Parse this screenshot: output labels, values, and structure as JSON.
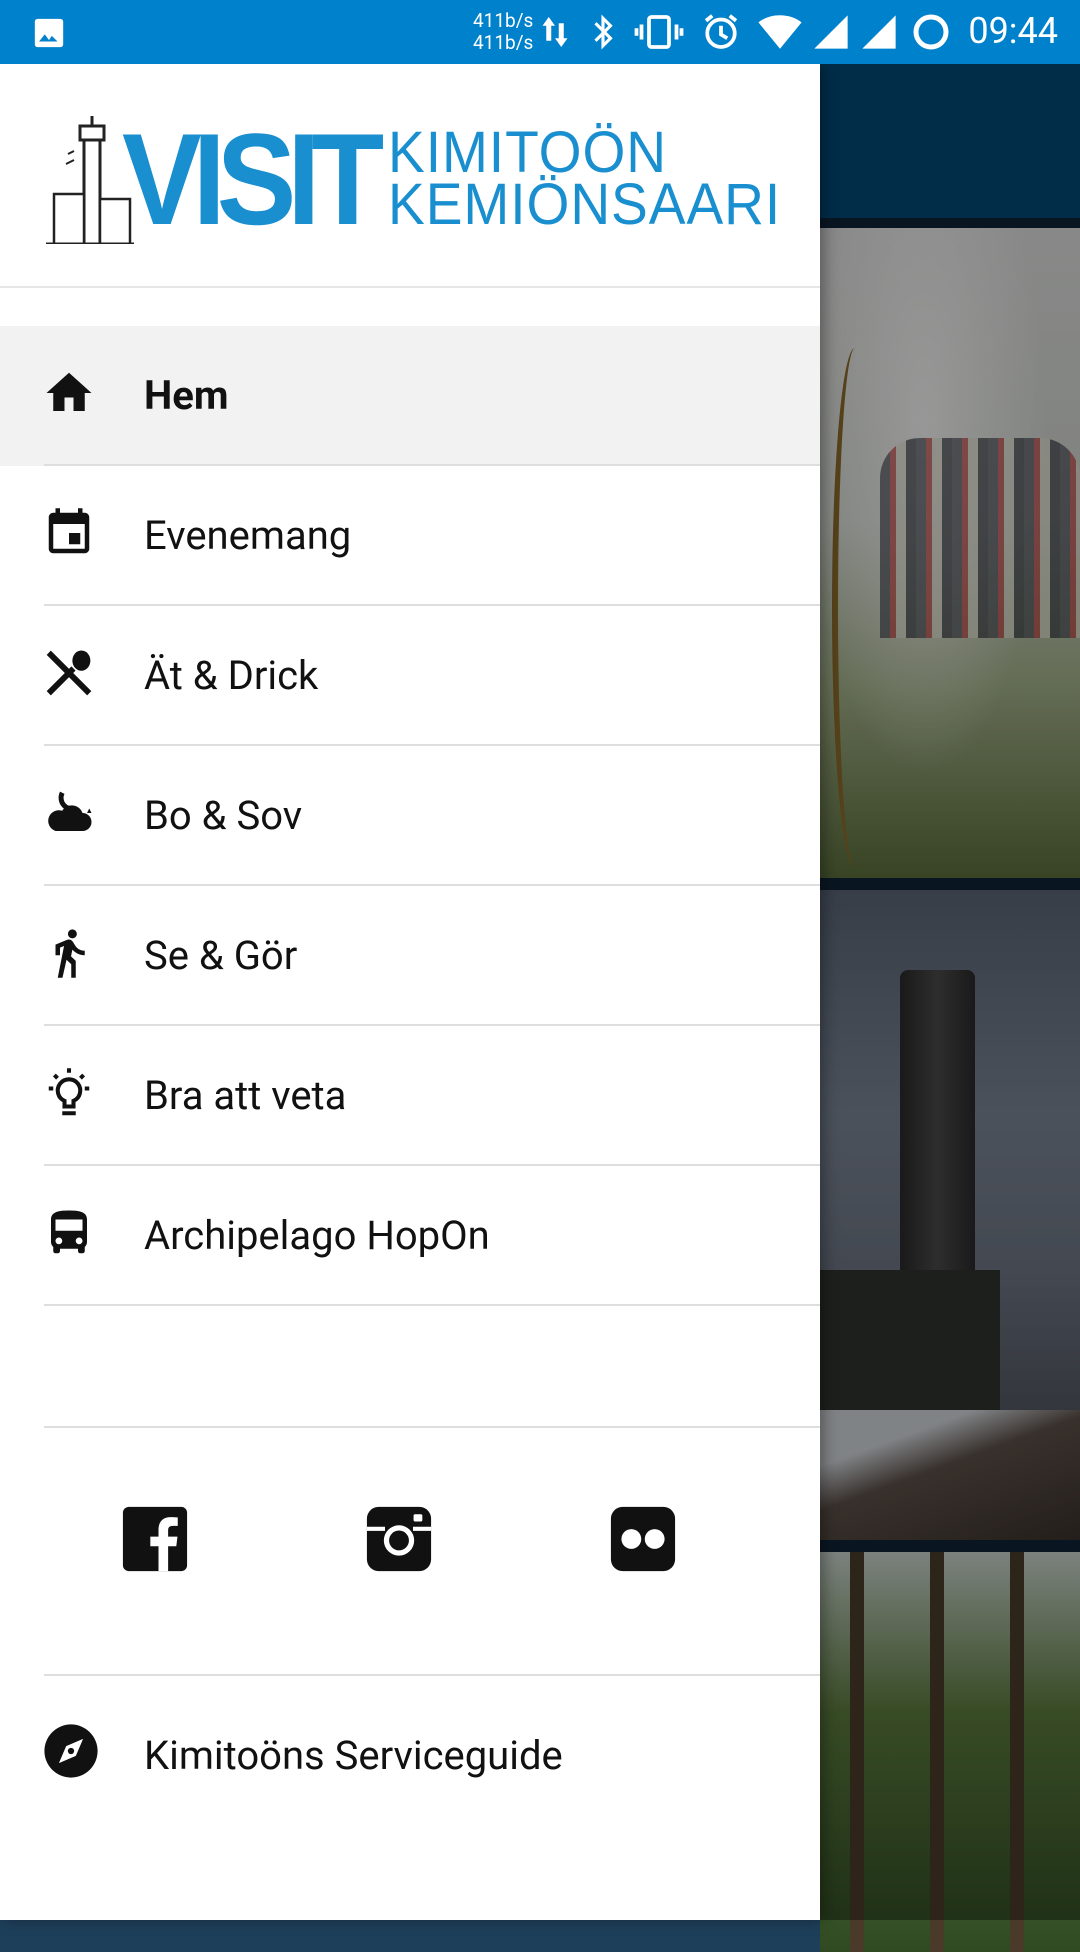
{
  "status_bar": {
    "speed_up": "411b/s",
    "speed_down": "411b/s",
    "time": "09:44",
    "icons": [
      "image-icon",
      "data-arrows-icon",
      "bluetooth-icon",
      "vibrate-icon",
      "alarm-icon",
      "wifi-icon",
      "signal-icon",
      "signal-icon",
      "battery-charging-icon"
    ]
  },
  "logo": {
    "word": "VISIT",
    "line1": "KIMITOÖN",
    "line2": "KEMIÖNSAARI",
    "color": "#1a8fd0"
  },
  "menu": {
    "items": [
      {
        "label": "Hem",
        "icon": "home-icon",
        "active": true
      },
      {
        "label": "Evenemang",
        "icon": "calendar-icon",
        "active": false
      },
      {
        "label": "Ät & Drick",
        "icon": "restaurant-icon",
        "active": false
      },
      {
        "label": "Bo & Sov",
        "icon": "night-icon",
        "active": false
      },
      {
        "label": "Se & Gör",
        "icon": "walk-icon",
        "active": false
      },
      {
        "label": "Bra att veta",
        "icon": "lightbulb-icon",
        "active": false
      },
      {
        "label": "Archipelago HopOn",
        "icon": "bus-icon",
        "active": false
      }
    ]
  },
  "social": [
    "facebook-icon",
    "instagram-icon",
    "flickr-icon"
  ],
  "service": {
    "label": "Kimitoöns Serviceguide",
    "icon": "compass-icon"
  },
  "colors": {
    "statusbar": "#0081cc",
    "appbar": "#034a76"
  }
}
